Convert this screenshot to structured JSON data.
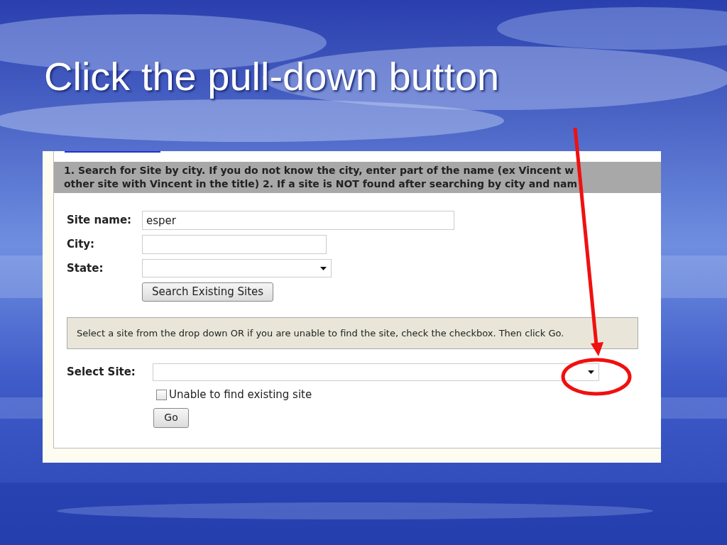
{
  "slide": {
    "title": "Click the pull-down button"
  },
  "form": {
    "instructions": [
      "1. Search for Site by city. If you do not know the city, enter part of the name (ex Vincent w",
      "other site with Vincent in the title) 2. If a site is NOT found after searching by city and nam"
    ],
    "fields": [
      {
        "kind": "text",
        "label": "Site name:",
        "value": "esper"
      },
      {
        "kind": "text",
        "label": "City:"
      },
      {
        "kind": "select",
        "label": "State:"
      }
    ],
    "search_button": "Search Existing Sites",
    "notice": "Select a site from the drop down OR if you are unable to find the site, check the checkbox. Then click Go.",
    "select_site": {
      "label": "Select Site:"
    },
    "checkbox": {
      "label": "Unable to find existing site",
      "checked": false
    },
    "go_button": "Go"
  }
}
